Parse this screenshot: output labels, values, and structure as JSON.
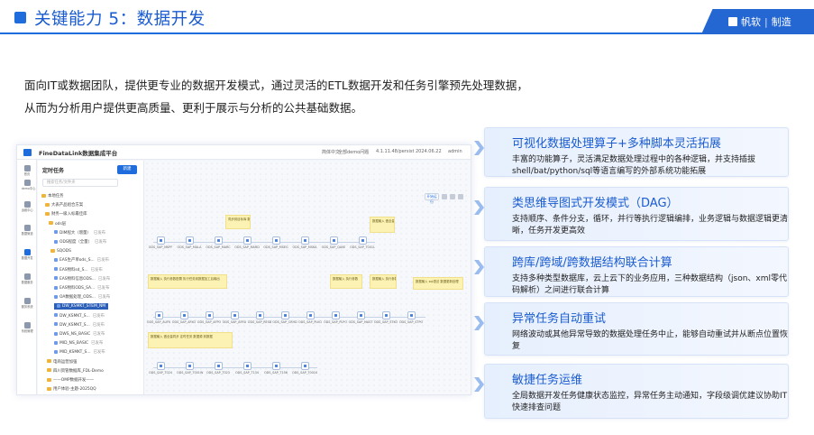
{
  "header": {
    "title": "关键能力 5：数据开发",
    "brand": {
      "name": "帆软",
      "separator": "|",
      "suffix": "制造"
    }
  },
  "intro": {
    "line1": "面向IT或数据团队，提供更专业的数据开发模式，通过灵活的ETL数据开发和任务引擎预先处理数据，",
    "line2": "从而为分析用户提供更高质量、更利于展示与分析的公共基础数据。"
  },
  "app": {
    "title": "FineDataLink数据集成平台",
    "topbar": {
      "lang": "简体中文",
      "user_group": "全部demo问题",
      "version": "4.1.11.48/persist 2024.06.22",
      "account": "admin"
    },
    "nav": [
      {
        "label": "首页",
        "icon": "home-icon"
      },
      {
        "label": "demo中心",
        "icon": "demo-icon"
      },
      {
        "label": "运维中心",
        "icon": "ops-icon"
      },
      {
        "label": "数据管道",
        "icon": "pipeline-icon"
      },
      {
        "label": "数据开发",
        "icon": "dev-icon"
      },
      {
        "label": "数据服务",
        "icon": "service-icon"
      },
      {
        "label": "服务系统",
        "icon": "system-icon"
      },
      {
        "label": "系统管理",
        "icon": "settings-icon"
      }
    ],
    "tree": {
      "header": "定时任务",
      "new_button": "新建",
      "search_placeholder": "搜索任务/文件夹",
      "items": [
        {
          "label": "本地任务",
          "type": "folder",
          "status": ""
        },
        {
          "label": "大表产品组合方案",
          "type": "folder",
          "status": ""
        },
        {
          "label": "财务一级入标最佳库",
          "type": "folder",
          "status": ""
        },
        {
          "label": "ods层",
          "type": "folder",
          "status": ""
        },
        {
          "label": "DIM程大（增量）",
          "type": "task",
          "status": "已发布"
        },
        {
          "label": "ODS程度（全量）",
          "type": "task",
          "status": "已发布"
        },
        {
          "label": "SQODS",
          "type": "folder",
          "status": ""
        },
        {
          "label": "EAS生产单ods_S...",
          "type": "task",
          "status": "已发布"
        },
        {
          "label": "EAS物料sd_S...",
          "type": "task",
          "status": "已发布"
        },
        {
          "label": "EAS物料信息ODS...",
          "type": "task",
          "status": "已发布"
        },
        {
          "label": "EAS物料ODS_SA...",
          "type": "task",
          "status": "已发布"
        },
        {
          "label": "OA数据处理_ODS...",
          "type": "task",
          "status": "已发布"
        },
        {
          "label": "DW_KSMKT_STEM_NM",
          "type": "task",
          "status": ""
        },
        {
          "label": "DW_KSMKT_S...",
          "type": "task",
          "status": "已发布"
        },
        {
          "label": "DW_KSMKT_S...",
          "type": "task",
          "status": "已发布"
        },
        {
          "label": "DWS_NS_BASIC",
          "type": "task",
          "status": "已发布"
        },
        {
          "label": "MID_NS_BASIC",
          "type": "task",
          "status": "已发布"
        },
        {
          "label": "MID_KSMKT_S...",
          "type": "task",
          "status": "已发布"
        },
        {
          "label": "电商运营加强",
          "type": "folder",
          "status": ""
        },
        {
          "label": "四川资管数据库_FDL-Demo",
          "type": "folder",
          "status": ""
        },
        {
          "label": "——OMP数据开发——",
          "type": "folder",
          "status": ""
        },
        {
          "label": "用户体验-主题-2025QQ",
          "type": "folder",
          "status": ""
        }
      ]
    },
    "canvas": {
      "run_label": "开始运行",
      "notes": [
        "同步到目标库 数据源同步",
        "数据输入 做全量同步 定时任务数据源",
        "数据输入 执行参数配置 执行任务到数据加工后输出",
        "数据输入 执行参数",
        "数据输入 执行参数",
        "数据输入 sql语法 数据更新处理",
        "数据输入 做全量同步 定时任务 数据源 到数据"
      ],
      "row1": [
        "ODS_SAP_MKPF",
        "ODS_SAP_MALA",
        "ODS_SAP_MARC",
        "ODS_SAP_MARD",
        "ODS_SAP_MSEG",
        "ODS_SAP_MSKA",
        "ODS_SAP_QAVE",
        "ODS_SAP_T001L"
      ],
      "row2": [
        "ODS_SAP_AUFK",
        "ODS_SAP_AFKO",
        "ODS_SAP_AFPO",
        "ODS_SAP_AFRU",
        "ODS_SAP_RESB",
        "ODS_SAP_CRHD",
        "ODS_SAP_PLKO",
        "ODS_SAP_PLPO",
        "ODS_SAP_MAST",
        "ODS_SAP_STKO",
        "ODS_SAP_STPO"
      ],
      "row3": [
        "ODS_SAP_T024",
        "ODS_SAP_T001W",
        "ODS_SAP_T023",
        "ODS_SAP_T134",
        "ODS_SAP_T156",
        "ODS_SAP_T001K"
      ]
    }
  },
  "cards": [
    {
      "title": "可视化数据处理算子+多种脚本灵活拓展",
      "desc": "丰富的功能算子，灵活满足数据处理过程中的各种逻辑，并支持插拔shell/bat/python/sql等语言编写的外部系统功能拓展"
    },
    {
      "title": "类思维导图式开发模式（DAG）",
      "desc": "支持顺序、条件分支，循环，并行等执行逻辑编排，业务逻辑与数据逻辑更清晰，任务开发更高效"
    },
    {
      "title": "跨库/跨域/跨数据结构联合计算",
      "desc": "支持多种类型数据库，云上云下的业务应用，三种数据结构（json、xml零代码解析）之间进行联合计算"
    },
    {
      "title": "异常任务自动重试",
      "desc": "网络波动或其他异常导致的数据处理任务中止，能够自动重试并从断点位置恢复"
    },
    {
      "title": "敏捷任务运维",
      "desc": "全局数据开发任务健康状态监控，异常任务主动通知，字段级调优建议协助IT快速排查问题"
    }
  ],
  "colors": {
    "accent": "#1f6ddc",
    "title": "#1a5cd0",
    "card_bg": "#e9f1fd",
    "note": "#fbf2b4"
  }
}
